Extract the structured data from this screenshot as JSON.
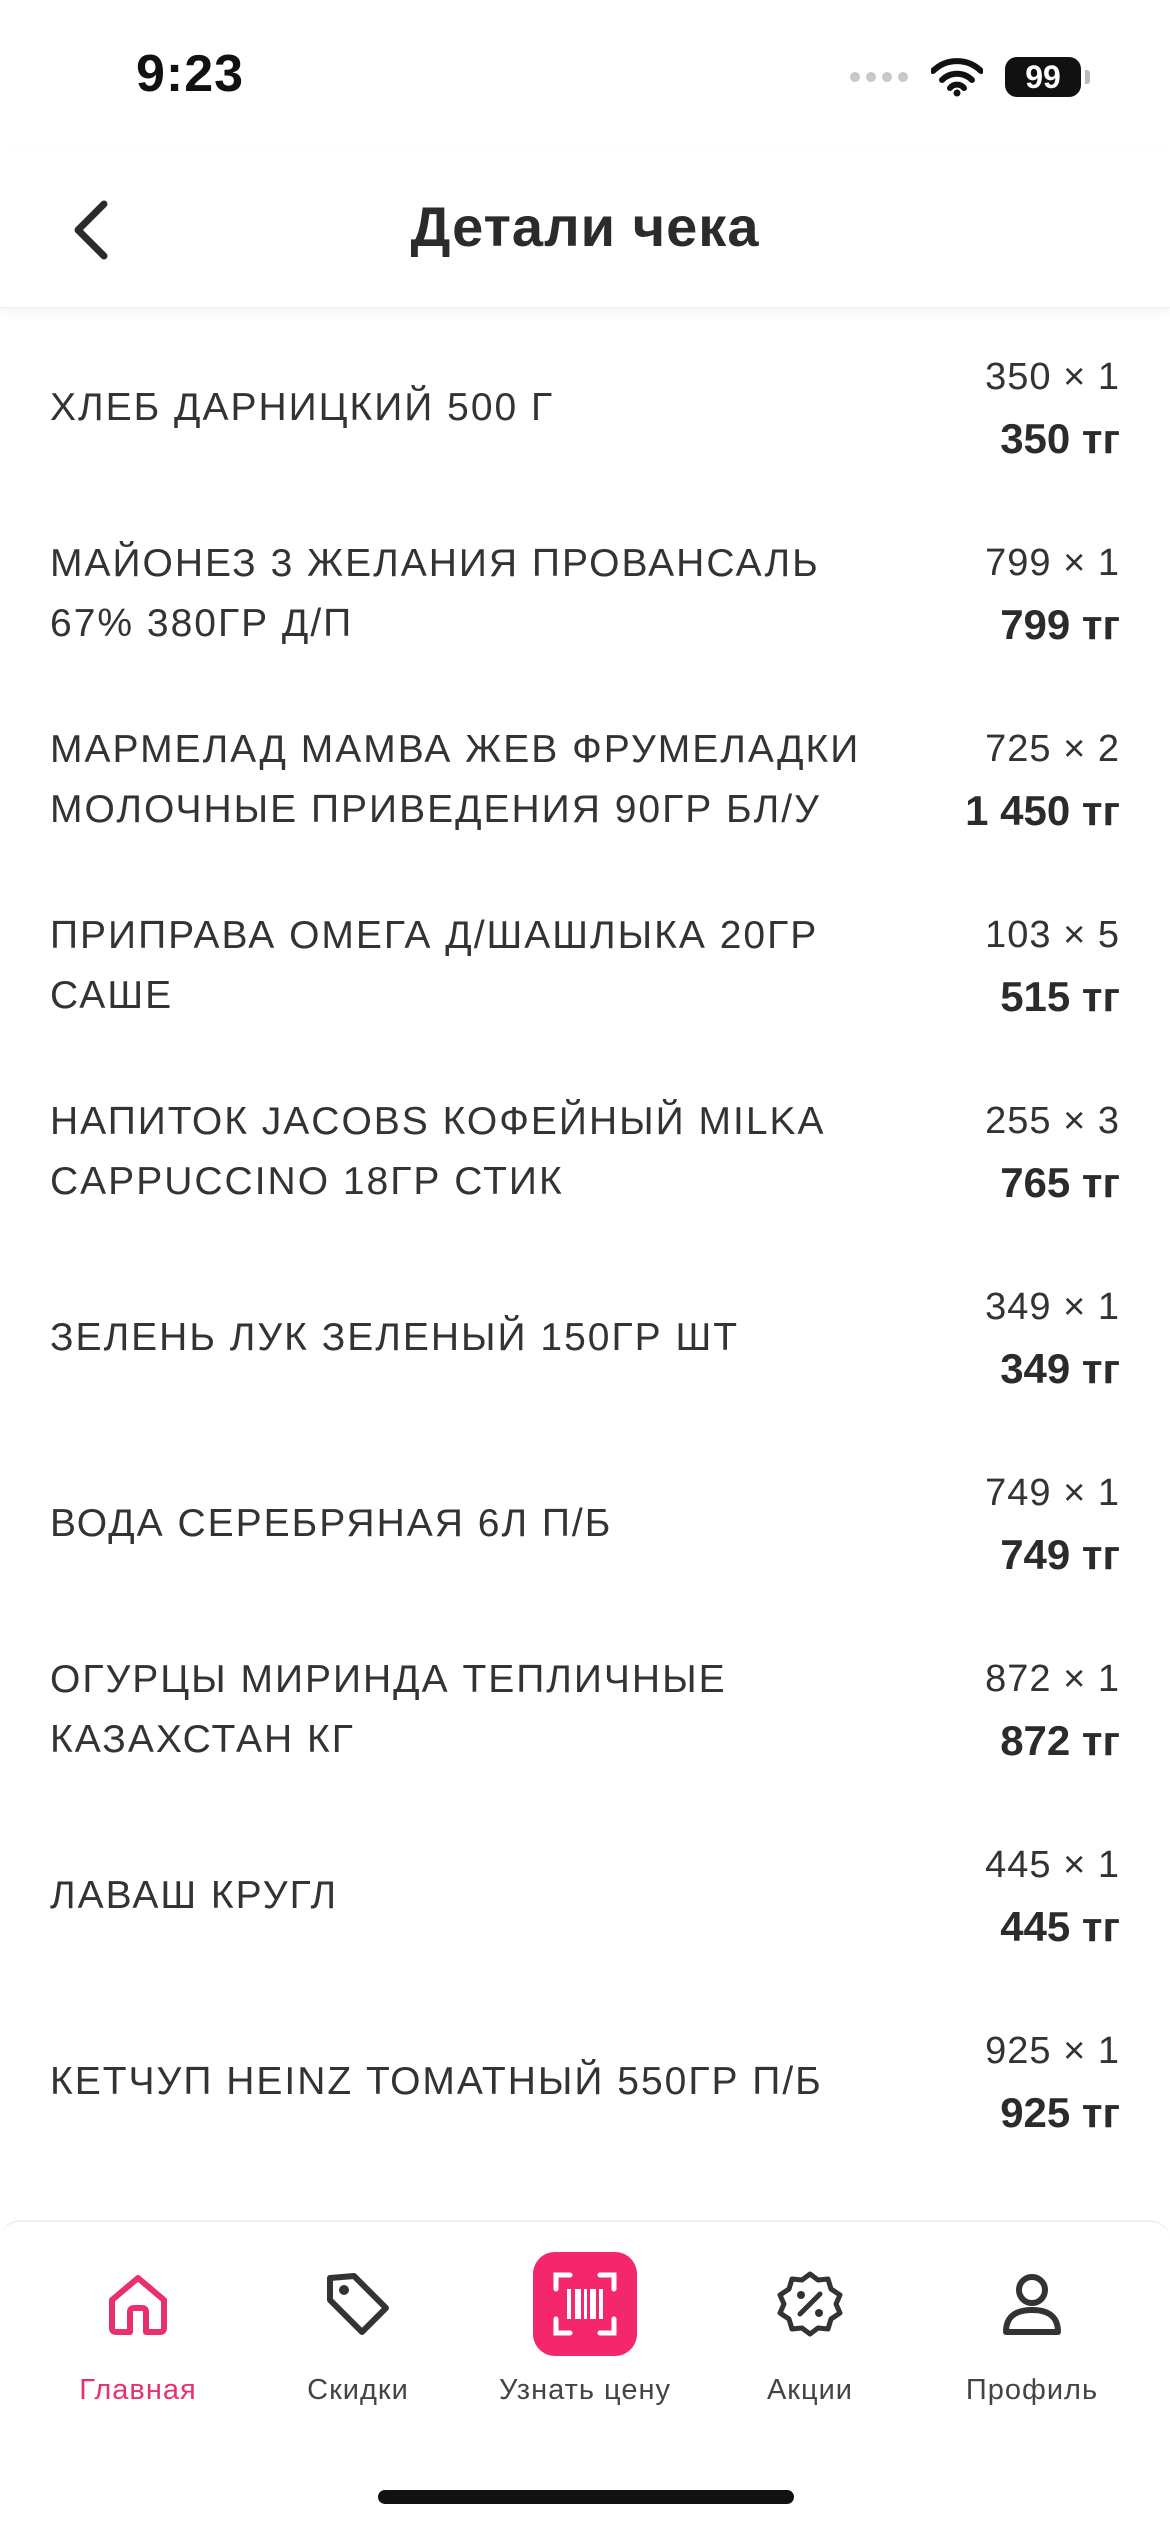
{
  "status_bar": {
    "time": "9:23",
    "battery": "99"
  },
  "header": {
    "title": "Детали чека"
  },
  "items": [
    {
      "name": "ХЛЕБ ДАРНИЦКИЙ 500 Г",
      "qty": "350 × 1",
      "total": "350 тг"
    },
    {
      "name": "МАЙОНЕЗ 3 ЖЕЛАНИЯ ПРОВАНСАЛЬ 67% 380ГР Д/П",
      "qty": "799 × 1",
      "total": "799 тг"
    },
    {
      "name": "МАРМЕЛАД МАМВА ЖЕВ ФРУМЕЛАДКИ МОЛОЧНЫЕ ПРИВЕДЕНИЯ 90ГР БЛ/У",
      "qty": "725 × 2",
      "total": "1 450 тг"
    },
    {
      "name": "ПРИПРАВА ОМЕГА Д/ШАШЛЫКА 20ГР САШЕ",
      "qty": "103 × 5",
      "total": "515 тг"
    },
    {
      "name": "НАПИТОК JACOBS КОФЕЙНЫЙ MILKA CAPPUCCINO 18ГР СТИК",
      "qty": "255 × 3",
      "total": "765 тг"
    },
    {
      "name": "ЗЕЛЕНЬ ЛУК ЗЕЛЕНЫЙ 150ГР ШТ",
      "qty": "349 × 1",
      "total": "349 тг"
    },
    {
      "name": "ВОДА СЕРЕБРЯНАЯ 6Л П/Б",
      "qty": "749 × 1",
      "total": "749 тг"
    },
    {
      "name": "ОГУРЦЫ МИРИНДА ТЕПЛИЧНЫЕ КАЗАХСТАН КГ",
      "qty": "872 × 1",
      "total": "872 тг"
    },
    {
      "name": "ЛАВАШ КРУГЛ",
      "qty": "445 × 1",
      "total": "445 тг"
    },
    {
      "name": "КЕТЧУП HEINZ ТОМАТНЫЙ 550ГР П/Б",
      "qty": "925 × 1",
      "total": "925 тг"
    }
  ],
  "tabbar": {
    "home": "Главная",
    "discounts": "Скидки",
    "price_check": "Узнать цену",
    "promotions": "Акции",
    "profile": "Профиль"
  },
  "colors": {
    "accent": "#f5276c",
    "active_label": "#e8306d",
    "text": "#2b2b2b"
  },
  "icons": {
    "back": "chevron-left-icon",
    "home": "home-icon",
    "discounts": "tag-icon",
    "price_check": "barcode-scan-icon",
    "promotions": "percent-badge-icon",
    "profile": "user-icon"
  }
}
